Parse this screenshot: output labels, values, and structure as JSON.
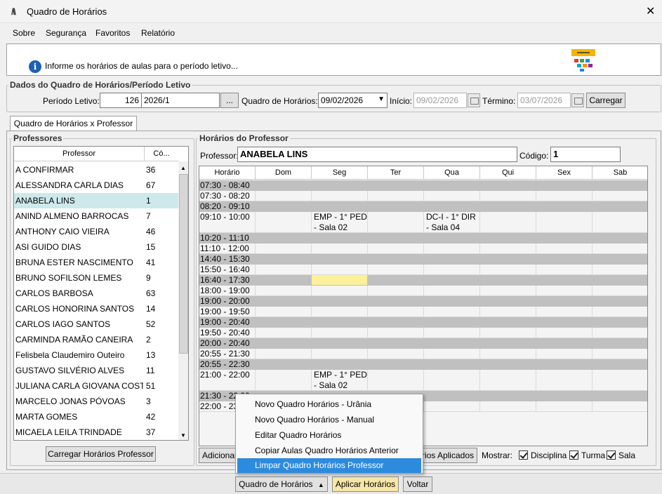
{
  "window": {
    "title": "Quadro de Horários",
    "close_glyph": "✕"
  },
  "menu": [
    "Sobre",
    "Segurança",
    "Favoritos",
    "Relatório"
  ],
  "info": {
    "icon_glyph": "i",
    "text": "Informe os horários de aulas para o período letivo..."
  },
  "dados": {
    "legend": "Dados do Quadro de Horários/Período Letivo",
    "periodo_label": "Período Letivo:",
    "periodo_code": "126",
    "periodo_value": "2026/1",
    "ellipsis_button": "...",
    "quadro_label": "Quadro de Horários:",
    "quadro_value": "09/02/2026",
    "inicio_label": "Início:",
    "inicio_value": "09/02/2026",
    "termino_label": "Término:",
    "termino_value": "03/07/2026",
    "carregar_button": "Carregar"
  },
  "tab_label": "Quadro de Horários x Professor",
  "professores": {
    "legend": "Professores",
    "col_professor": "Professor",
    "col_codigo": "Có...",
    "rows": [
      {
        "name": "A CONFIRMAR",
        "code": "36"
      },
      {
        "name": "ALESSANDRA CARLA DIAS",
        "code": "67"
      },
      {
        "name": "ANABELA LINS",
        "code": "1"
      },
      {
        "name": "ANIND ALMENO BARROCAS",
        "code": "7"
      },
      {
        "name": "ANTHONY CAIO VIEIRA",
        "code": "46"
      },
      {
        "name": "ASI GUIDO DIAS",
        "code": "15"
      },
      {
        "name": "BRUNA ESTER NASCIMENTO",
        "code": "41"
      },
      {
        "name": "BRUNO SOFILSON LEMES",
        "code": "9"
      },
      {
        "name": "CARLOS BARBOSA",
        "code": "63"
      },
      {
        "name": "CARLOS HONORINA SANTOS",
        "code": "14"
      },
      {
        "name": "CARLOS IAGO SANTOS",
        "code": "52"
      },
      {
        "name": "CARMINDA RAMÃO CANEIRA",
        "code": "2"
      },
      {
        "name": "Felisbela Claudemiro Outeiro",
        "code": "13"
      },
      {
        "name": "GUSTAVO SILVÉRIO ALVES",
        "code": "11"
      },
      {
        "name": "JULIANA CARLA GIOVANA COSTA",
        "code": "51"
      },
      {
        "name": "MARCELO JONAS PÓVOAS",
        "code": "3"
      },
      {
        "name": "MARTA GOMES",
        "code": "42"
      },
      {
        "name": "MICAELA LEILA TRINDADE",
        "code": "37"
      }
    ],
    "carregar_button": "Carregar Horários Professor"
  },
  "horarios": {
    "legend": "Horários do Professor",
    "professor_label": "Professor:",
    "professor_value": "ANABELA LINS",
    "codigo_label": "Código:",
    "codigo_value": "1",
    "columns": [
      "Horário",
      "Dom",
      "Seg",
      "Ter",
      "Qua",
      "Qui",
      "Sex",
      "Sab"
    ],
    "rows": [
      {
        "time": "07:30 - 08:40",
        "gray": true,
        "cells": [
          "",
          "",
          "",
          "",
          "",
          "",
          ""
        ]
      },
      {
        "time": "07:30 - 08:20",
        "gray": false,
        "cells": [
          "",
          "",
          "",
          "",
          "",
          "",
          ""
        ]
      },
      {
        "time": "08:20 - 09:10",
        "gray": true,
        "cells": [
          "",
          "",
          "",
          "",
          "",
          "",
          ""
        ]
      },
      {
        "time": "09:10 - 10:00",
        "gray": false,
        "cells": [
          "",
          "EMP - 1° PED - Sala 02",
          "",
          "DC-I - 1° DIR - Sala 04",
          "",
          "",
          ""
        ]
      },
      {
        "time": "10:20 - 11:10",
        "gray": true,
        "cells": [
          "",
          "",
          "",
          "",
          "",
          "",
          ""
        ]
      },
      {
        "time": "11:10 - 12:00",
        "gray": false,
        "cells": [
          "",
          "",
          "",
          "",
          "",
          "",
          ""
        ]
      },
      {
        "time": "14:40 - 15:30",
        "gray": true,
        "cells": [
          "",
          "",
          "",
          "",
          "",
          "",
          ""
        ]
      },
      {
        "time": "15:50 - 16:40",
        "gray": false,
        "cells": [
          "",
          "",
          "",
          "",
          "",
          "",
          ""
        ]
      },
      {
        "time": "16:40 - 17:30",
        "gray": true,
        "cells": [
          "",
          "",
          "",
          "",
          "",
          "",
          ""
        ]
      },
      {
        "time": "18:00 - 19:00",
        "gray": false,
        "cells": [
          "",
          "",
          "",
          "",
          "",
          "",
          ""
        ]
      },
      {
        "time": "19:00 - 20:00",
        "gray": true,
        "cells": [
          "",
          "",
          "",
          "",
          "",
          "",
          ""
        ]
      },
      {
        "time": "19:00 - 19:50",
        "gray": false,
        "cells": [
          "",
          "",
          "",
          "",
          "",
          "",
          ""
        ]
      },
      {
        "time": "19:00 - 20:40",
        "gray": true,
        "cells": [
          "",
          "",
          "",
          "",
          "",
          "",
          ""
        ]
      },
      {
        "time": "19:50 - 20:40",
        "gray": false,
        "cells": [
          "",
          "",
          "",
          "",
          "",
          "",
          ""
        ]
      },
      {
        "time": "20:00 - 20:40",
        "gray": true,
        "cells": [
          "",
          "",
          "",
          "",
          "",
          "",
          ""
        ]
      },
      {
        "time": "20:55 - 21:30",
        "gray": false,
        "cells": [
          "",
          "",
          "",
          "",
          "",
          "",
          ""
        ]
      },
      {
        "time": "20:55 - 22:30",
        "gray": true,
        "cells": [
          "",
          "",
          "",
          "",
          "",
          "",
          ""
        ]
      },
      {
        "time": "21:00 - 22:00",
        "gray": false,
        "cells": [
          "",
          "EMP - 1° PED - Sala 02",
          "",
          "",
          "",
          "",
          ""
        ]
      },
      {
        "time": "21:30 - 22:00",
        "gray": true,
        "cells": [
          "",
          "",
          "",
          "",
          "",
          "",
          ""
        ]
      },
      {
        "time": "22:00 - 23:00",
        "gray": false,
        "cells": [
          "",
          "",
          "",
          "",
          "",
          "",
          ""
        ]
      }
    ],
    "adicionar_button": "Adicionar",
    "aplicados_button": "Horários Aplicados",
    "mostrar_label": "Mostrar:",
    "chk_disciplina": "Disciplina",
    "chk_turma": "Turma",
    "chk_sala": "Sala"
  },
  "popup_menu": [
    "Novo Quadro Horários - Urânia",
    "Novo Quadro Horários - Manual",
    "Editar Quadro Horários",
    "Copiar Aulas Quadro Horários Anterior",
    "Limpar Quadro Horários Professor"
  ],
  "footer": {
    "quadro_button": "Quadro de Horários",
    "aplicar_button": "Aplicar Horários",
    "voltar_button": "Voltar"
  },
  "colors": {
    "selected_row": "#cde9ec",
    "gray_row": "#c0c0c0",
    "highlight_cell": "#fcf19a",
    "menu_active": "#2d8bde",
    "aplicar_bg": "#f6e7a8"
  }
}
